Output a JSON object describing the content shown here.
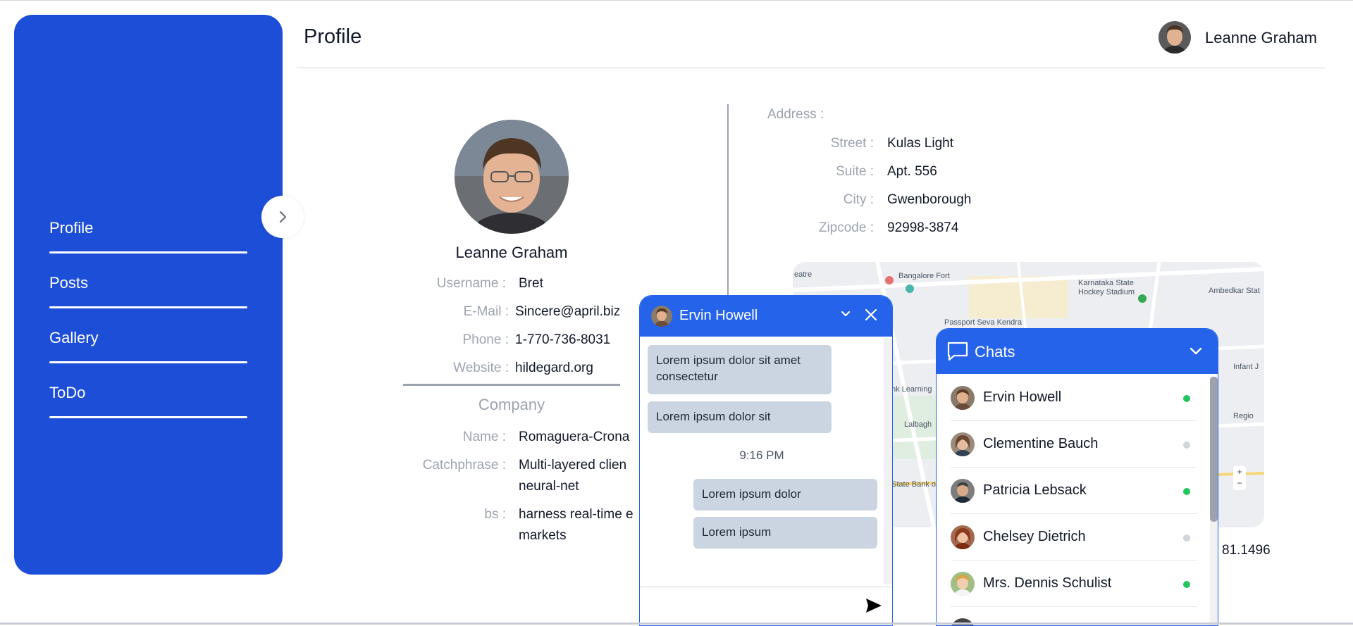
{
  "sidebar": {
    "items": [
      {
        "label": "Profile"
      },
      {
        "label": "Posts"
      },
      {
        "label": "Gallery"
      },
      {
        "label": "ToDo"
      }
    ],
    "toggle_icon": "chevron-right-icon"
  },
  "header": {
    "title": "Profile",
    "user_name": "Leanne Graham"
  },
  "profile": {
    "name": "Leanne Graham",
    "fields": [
      {
        "label": "Username :",
        "value": "Bret"
      },
      {
        "label": "E-Mail :",
        "value": "Sincere@april.biz"
      },
      {
        "label": "Phone :",
        "value": "1-770-736-8031"
      },
      {
        "label": "Website :",
        "value": "hildegard.org"
      }
    ],
    "company_title": "Company",
    "company": [
      {
        "label": "Name :",
        "value": "Romaguera-Crona"
      },
      {
        "label": "Catchphrase :",
        "value_line1": "Multi-layered clien",
        "value_line2": "neural-net"
      },
      {
        "label": "bs :",
        "value_line1": "harness real-time e",
        "value_line2": "markets"
      }
    ]
  },
  "address": {
    "title": "Address :",
    "fields": [
      {
        "label": "Street :",
        "value": "Kulas Light"
      },
      {
        "label": "Suite :",
        "value": "Apt. 556"
      },
      {
        "label": "City :",
        "value": "Gwenborough"
      },
      {
        "label": "Zipcode :",
        "value": "92998-3874"
      }
    ],
    "geo_partial": "81.1496",
    "map_labels": [
      "Bangalore Fort",
      "Karnataka State",
      "Hockey Stadium",
      "Passport Seva Kendra",
      "Ambedkar Stat",
      "nk Learning",
      "Lalbagh",
      "State Bank o",
      "Infant J",
      "Regio",
      "eatre"
    ]
  },
  "chat_window": {
    "contact_name": "Ervin Howell",
    "messages": [
      {
        "text": "Lorem ipsum dolor sit amet consectetur",
        "side": "left"
      },
      {
        "text": "Lorem ipsum dolor sit",
        "side": "left"
      },
      {
        "text": "Lorem ipsum dolor",
        "side": "right"
      },
      {
        "text": "Lorem ipsum",
        "side": "right"
      }
    ],
    "time": "9:16 PM",
    "send_icon": "send-icon"
  },
  "chats": {
    "title": "Chats",
    "contacts": [
      {
        "name": "Ervin Howell",
        "online": true
      },
      {
        "name": "Clementine Bauch",
        "online": false
      },
      {
        "name": "Patricia Lebsack",
        "online": true
      },
      {
        "name": "Chelsey Dietrich",
        "online": false
      },
      {
        "name": "Mrs. Dennis Schulist",
        "online": true
      }
    ],
    "online_color": "#22c55e",
    "offline_color": "#d1d5db"
  },
  "colors": {
    "brand": "#1d4ed8",
    "accent": "#2563eb",
    "bubble": "#cbd5e1",
    "muted": "#9ca3af"
  }
}
